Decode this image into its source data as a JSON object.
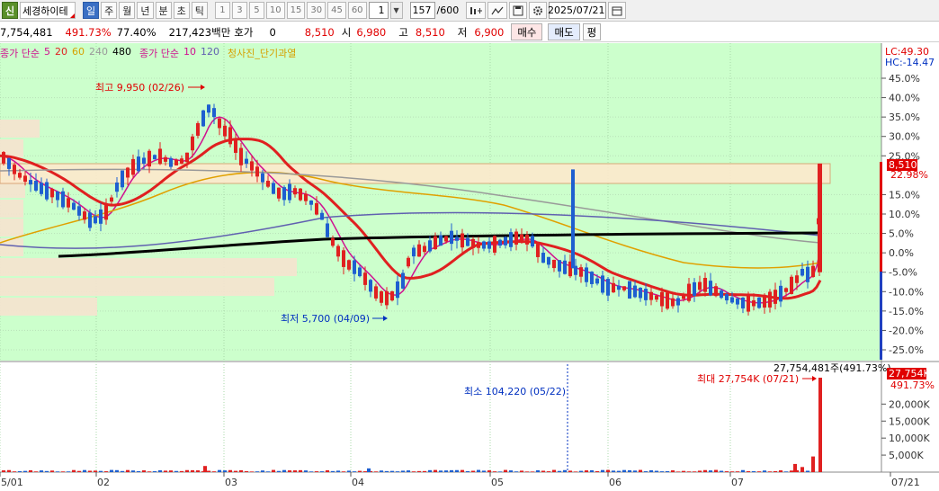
{
  "toolbar": {
    "stock_icon": "신",
    "stock_name": "세경하이테",
    "periods": [
      "일",
      "주",
      "월",
      "년",
      "분",
      "초",
      "틱"
    ],
    "active_period": "일",
    "intervals": [
      "1",
      "3",
      "5",
      "10",
      "15",
      "30",
      "45",
      "60"
    ],
    "interval_value": "1",
    "count": "157",
    "count_total": "/600",
    "date": "2025/07/21",
    "icons": [
      "crosshair-tool-icon",
      "drawing-tool-icon",
      "save-icon",
      "settings-icon",
      "calendar-icon"
    ]
  },
  "infobar": {
    "volume": "7,754,481",
    "volume_rate": "491.73%",
    "turnover": "77.40%",
    "amount": "217,423백만",
    "hoga_label": "호가",
    "hoga_value": "0",
    "price": "8,510",
    "open_label": "시",
    "open_value": "6,980",
    "high_label": "고",
    "high_value": "8,510",
    "low_label": "저",
    "low_value": "6,900",
    "buy_label": "매수",
    "sell_label": "매도",
    "avg_label": "평"
  },
  "legend": {
    "ma_label": "종가 단순",
    "ma_values": [
      "5",
      "20",
      "60",
      "240",
      "480"
    ],
    "ma_colors": [
      "#d01090",
      "#e02020",
      "#d6a000",
      "#999999",
      "#000000"
    ],
    "ma2_label": "종가 단순",
    "ma2_values": [
      "10",
      "120"
    ],
    "ma2_colors": [
      "#d01090",
      "#6060b0"
    ],
    "indicator": "청사진_단기과열"
  },
  "right_labels": {
    "lc": "LC:49.30",
    "hc": "HC:-14.47",
    "price_tag": "8,510",
    "price_pct": "22.98%",
    "vol_tag": "27,754K",
    "vol_pct": "491.73%"
  },
  "annotations": {
    "high": "최고 9,950 (02/26)",
    "low": "최저 5,700 (04/09)",
    "vol_min": "최소 104,220 (05/22)",
    "vol_max": "최대 27,754K (07/21)",
    "vol_top": "27,754,481주(491.73%)"
  },
  "chart_data": {
    "type": "candlestick",
    "price_axis": {
      "ticks": [
        "45.0%",
        "40.0%",
        "35.0%",
        "30.0%",
        "25.0%",
        "22.98%",
        "15.0%",
        "10.0%",
        "5.0%",
        "0.0%",
        "-5.0%",
        "-10.0%",
        "-15.0%",
        "-20.0%",
        "-25.0%"
      ],
      "range_pct": [
        -27,
        47
      ]
    },
    "volume_axis": {
      "ticks": [
        "20,000K",
        "15,000K",
        "10,000K",
        "5,000K"
      ],
      "range": [
        0,
        29000
      ]
    },
    "x_labels": [
      "5/01",
      "02",
      "03",
      "04",
      "05",
      "06",
      "07",
      "07/21"
    ],
    "high": 9950,
    "low": 5700,
    "last": 8510,
    "vol_min": 104220,
    "vol_max": 27754481
  }
}
